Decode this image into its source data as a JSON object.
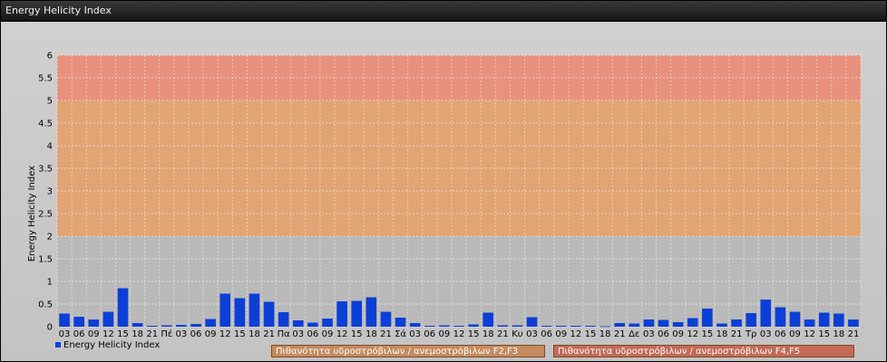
{
  "window": {
    "title": "Energy Helicity Index"
  },
  "chart_data": {
    "type": "bar",
    "ylabel": "Energy Helicity Index",
    "ylim": [
      0,
      6
    ],
    "yticks": [
      "0",
      "0.5",
      "1",
      "1.5",
      "2",
      "2.5",
      "3",
      "3.5",
      "4",
      "4.5",
      "5",
      "5.5",
      "6"
    ],
    "grid": true,
    "legend": "bottom-left",
    "categories": [
      "03",
      "06",
      "09",
      "12",
      "15",
      "18",
      "21",
      "Πέ",
      "03",
      "06",
      "09",
      "12",
      "15",
      "18",
      "21",
      "Πα",
      "03",
      "06",
      "09",
      "12",
      "15",
      "18",
      "21",
      "Σά",
      "03",
      "06",
      "09",
      "12",
      "15",
      "18",
      "21",
      "Κυ",
      "03",
      "06",
      "09",
      "12",
      "15",
      "18",
      "21",
      "Δε",
      "03",
      "06",
      "09",
      "12",
      "15",
      "18",
      "21",
      "Τρ",
      "03",
      "06",
      "09",
      "12",
      "15",
      "18",
      "21"
    ],
    "series": [
      {
        "name": "Energy Helicity Index",
        "color": "#0b3fd6",
        "values": [
          0.29,
          0.22,
          0.16,
          0.33,
          0.85,
          0.08,
          0.02,
          0.03,
          0.04,
          0.06,
          0.17,
          0.73,
          0.63,
          0.73,
          0.55,
          0.32,
          0.14,
          0.09,
          0.18,
          0.56,
          0.57,
          0.65,
          0.33,
          0.2,
          0.08,
          0.02,
          0.03,
          0.02,
          0.05,
          0.31,
          0.03,
          0.03,
          0.21,
          0.02,
          0.02,
          0.02,
          0.02,
          0.01,
          0.08,
          0.07,
          0.16,
          0.15,
          0.1,
          0.19,
          0.4,
          0.07,
          0.16,
          0.3,
          0.6,
          0.43,
          0.33,
          0.16,
          0.31,
          0.29,
          0.16
        ]
      }
    ],
    "bands": [
      {
        "from": 2,
        "to": 5,
        "color": "#e8a066",
        "label": "Πιθανότητα υδροστρόβιλων / ανεμοστρόβιλων F2,F3"
      },
      {
        "from": 5,
        "to": 6,
        "color": "#f08a72",
        "label": "Πιθανότητα υδροστρόβιλων / ανεμοστρόβιλων F4,F5"
      }
    ]
  }
}
